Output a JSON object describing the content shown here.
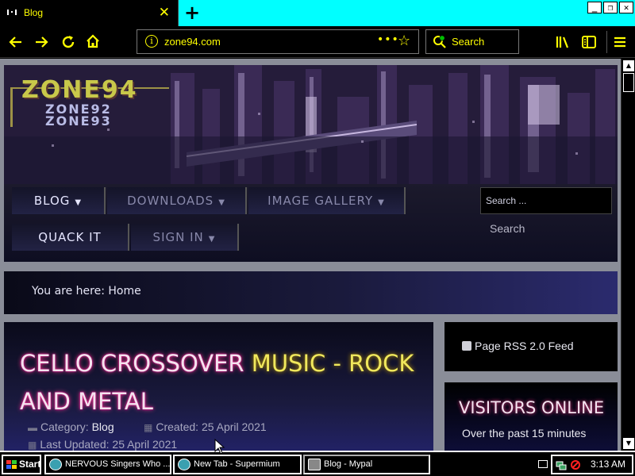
{
  "browser": {
    "tab_title": "Blog",
    "tab_close": "✕",
    "new_tab": "+",
    "url": "zone94.com",
    "url_more": "•••",
    "search_placeholder": "Search",
    "window_buttons": [
      "_",
      "❐",
      "✕"
    ]
  },
  "site": {
    "logo_line1": "ZONE94",
    "logo_line2": "ZONE92",
    "logo_line3": "ZONE93",
    "menu": [
      {
        "label": "BLOG",
        "caret": "▼"
      },
      {
        "label": "DOWNLOADS",
        "caret": "▼"
      },
      {
        "label": "IMAGE GALLERY",
        "caret": "▼"
      },
      {
        "label": "QUACK IT",
        "caret": ""
      },
      {
        "label": "SIGN IN",
        "caret": "▼"
      }
    ],
    "search_placeholder": "Search ...",
    "search_button": "Search",
    "breadcrumb_prefix": "You are here:",
    "breadcrumb_home": "Home"
  },
  "article": {
    "title_part1": "CELLO CROSSOVER ",
    "title_part2": "MUSIC - ROCK",
    "title_part3": "AND METAL",
    "category_label": "Category:",
    "category_value": "Blog",
    "created_label": "Created:",
    "created_value": "25 April 2021",
    "updated_label": "Last Updated:",
    "updated_value": "25 April 2021"
  },
  "sidebar": {
    "rss_label": "Page RSS 2.0 Feed",
    "visitors_title": "VISITORS ONLINE",
    "visitors_subtitle": "Over the past 15 minutes"
  },
  "taskbar": {
    "start": "Start",
    "tasks": [
      {
        "label": "NERVOUS Singers Who ..."
      },
      {
        "label": "New Tab - Supermium"
      },
      {
        "label": "Blog - Mypal"
      }
    ],
    "clock": "3:13 AM"
  },
  "colors": {
    "accent": "#ffff00",
    "tabstrip": "#00ffff",
    "page_bg": "#8a8d98"
  }
}
